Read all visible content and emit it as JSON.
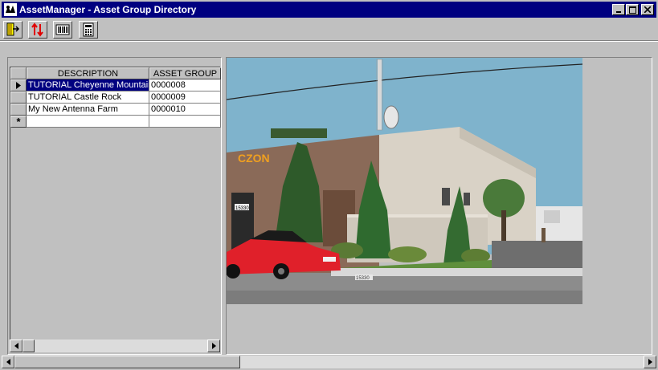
{
  "window": {
    "title": "AssetManager - Asset Group Directory"
  },
  "toolbar": {
    "buttons": [
      {
        "icon": "exit-door-icon"
      },
      {
        "icon": "sort-arrows-icon"
      },
      {
        "icon": "barcode-icon"
      },
      {
        "icon": "calculator-icon"
      }
    ]
  },
  "grid": {
    "columns": [
      "DESCRIPTION",
      "ASSET GROUP"
    ],
    "rows": [
      {
        "description": "TUTORIAL Cheyenne Mountain",
        "asset_group": "0000008",
        "selected": true
      },
      {
        "description": "TUTORIAL Castle Rock",
        "asset_group": "0000009",
        "selected": false
      },
      {
        "description": "My New Antenna Farm",
        "asset_group": "0000010",
        "selected": false
      }
    ],
    "new_row_marker": "*"
  },
  "photo": {
    "sign_text": "15330",
    "curb_text": "15330"
  },
  "colors": {
    "titlebar": "#000080",
    "selection": "#000080",
    "chrome": "#c0c0c0",
    "car_red": "#e0202a"
  }
}
